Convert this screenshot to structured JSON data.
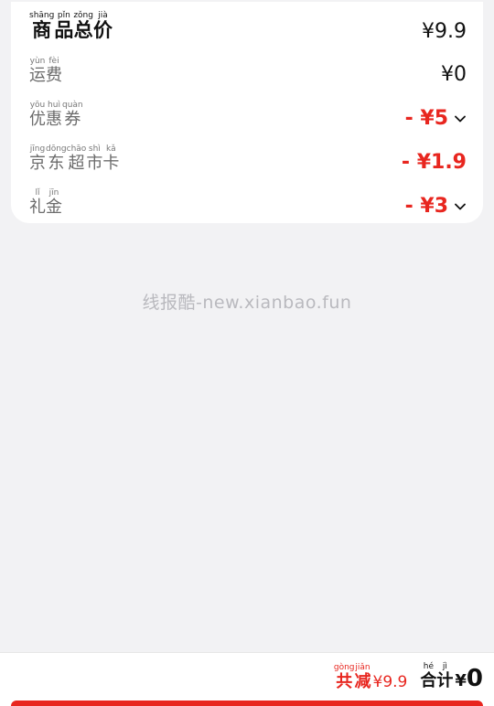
{
  "summary_card": {
    "goods_total": {
      "label": [
        {
          "char": "商",
          "py": "shāng"
        },
        {
          "char": "品",
          "py": "pǐn"
        },
        {
          "char": "总",
          "py": "zǒng"
        },
        {
          "char": "价",
          "py": "jià"
        }
      ],
      "value": "¥9.9"
    },
    "shipping": {
      "label": [
        {
          "char": "运",
          "py": "yùn"
        },
        {
          "char": "费",
          "py": "fèi"
        }
      ],
      "value": "¥0"
    },
    "coupon": {
      "label": [
        {
          "char": "优",
          "py": "yōu"
        },
        {
          "char": "惠",
          "py": "huì"
        },
        {
          "char": "券",
          "py": "quàn"
        }
      ],
      "value": "- ¥5"
    },
    "jd_supermarket_card": {
      "label": [
        {
          "char": "京",
          "py": "jīng"
        },
        {
          "char": "东",
          "py": "dōng"
        },
        {
          "char": "超",
          "py": "chāo"
        },
        {
          "char": "市",
          "py": "shì"
        },
        {
          "char": "卡",
          "py": "kǎ"
        }
      ],
      "value": "- ¥1.9"
    },
    "gift_money": {
      "label": [
        {
          "char": "礼",
          "py": "lǐ"
        },
        {
          "char": "金",
          "py": "jīn"
        }
      ],
      "value": "- ¥3"
    }
  },
  "watermark": "线报酷-new.xianbao.fun",
  "bottom_bar": {
    "reduce_label": [
      {
        "char": "共",
        "py": "gòng"
      },
      {
        "char": "减",
        "py": "jiǎn"
      }
    ],
    "reduce_amount": "¥9.9",
    "total_label": [
      {
        "char": "合",
        "py": "hé"
      },
      {
        "char": "计",
        "py": "jì"
      }
    ],
    "total_currency": "¥",
    "total_amount": "0"
  },
  "colors": {
    "accent_red": "#e8261f",
    "background": "#f2f2f4",
    "card": "#ffffff"
  }
}
